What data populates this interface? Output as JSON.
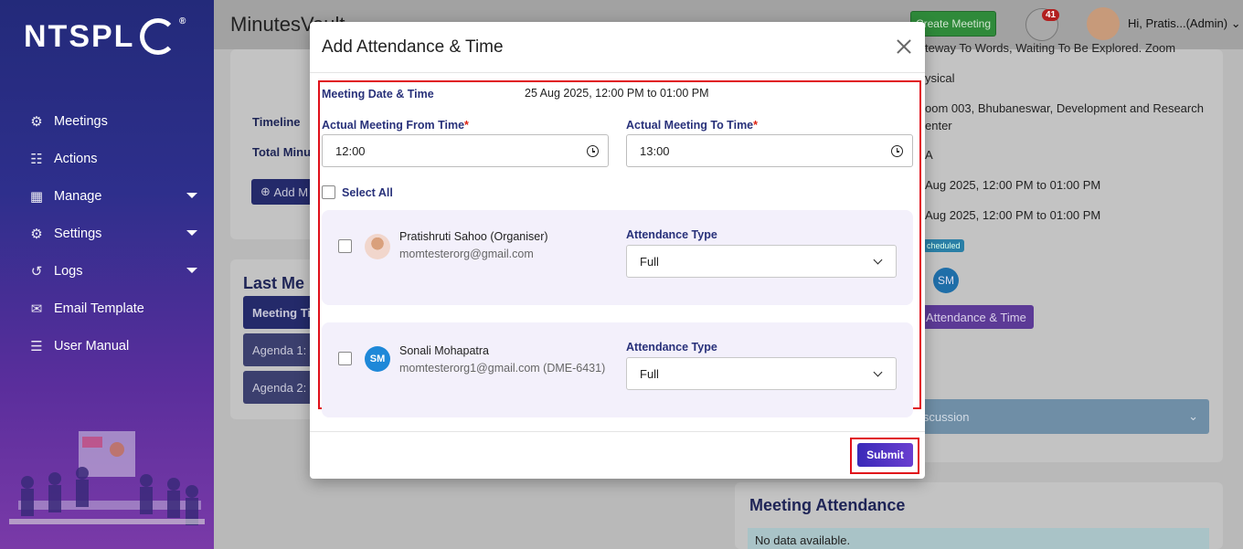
{
  "sidebar": {
    "brand": "NTSPL",
    "reg_mark": "®",
    "items": [
      {
        "label": "Meetings",
        "icon": "meetings-icon",
        "has_caret": false
      },
      {
        "label": "Actions",
        "icon": "clipboard-icon",
        "has_caret": false
      },
      {
        "label": "Manage",
        "icon": "grid-icon",
        "has_caret": true
      },
      {
        "label": "Settings",
        "icon": "gear-icon",
        "has_caret": true
      },
      {
        "label": "Logs",
        "icon": "history-icon",
        "has_caret": true
      },
      {
        "label": "Email Template",
        "icon": "envelope-icon",
        "has_caret": false
      },
      {
        "label": "User Manual",
        "icon": "book-icon",
        "has_caret": false
      }
    ]
  },
  "header": {
    "app_title": "MinutesVault",
    "create_meeting": "Create Meeting",
    "notification_count": "41",
    "user_greeting": "Hi, Pratis...(Admin)"
  },
  "background": {
    "timeline_label": "Timeline",
    "total_minutes_label": "Total Minut",
    "add_button": "Add M",
    "last_meeting_title": "Last Me",
    "meeting_tab": "Meeting Ti",
    "agenda1": "Agenda 1:",
    "agenda2": "Agenda 2:",
    "details": [
      "teway To Words, Waiting To Be Explored. Zoom",
      "ysical",
      "oom 003, Bhubaneswar, Development and Research",
      "enter",
      "A",
      "Aug 2025, 12:00 PM to 01:00 PM",
      "Aug 2025, 12:00 PM to 01:00 PM"
    ],
    "status_chip": "cheduled",
    "sm_initials": "SM",
    "attendance_time_button": "Attendance & Time",
    "discussion": "iscussion",
    "meeting_attendance_title": "Meeting Attendance",
    "no_data": "No data available."
  },
  "modal": {
    "title": "Add Attendance & Time",
    "meeting_date_label": "Meeting Date & Time",
    "meeting_date_value": "25 Aug 2025, 12:00 PM to 01:00 PM",
    "from_label": "Actual Meeting From Time",
    "to_label": "Actual Meeting To Time",
    "required_mark": "*",
    "from_value": "12:00",
    "to_value": "13:00",
    "select_all": "Select All",
    "attendance_type_label": "Attendance Type",
    "attendees": [
      {
        "name": "Pratishruti Sahoo (Organiser)",
        "email": "momtesterorg@gmail.com",
        "attendance": "Full",
        "initials": ""
      },
      {
        "name": "Sonali Mohapatra",
        "email": "momtesterorg1@gmail.com (DME-6431)",
        "attendance": "Full",
        "initials": "SM"
      }
    ],
    "submit": "Submit"
  },
  "colors": {
    "accent": "#28317a",
    "highlight": "#e0101a",
    "submit_gradient_start": "#3a2ab8",
    "submit_gradient_end": "#6a3ed0",
    "card_bg": "#f3f0fb"
  }
}
